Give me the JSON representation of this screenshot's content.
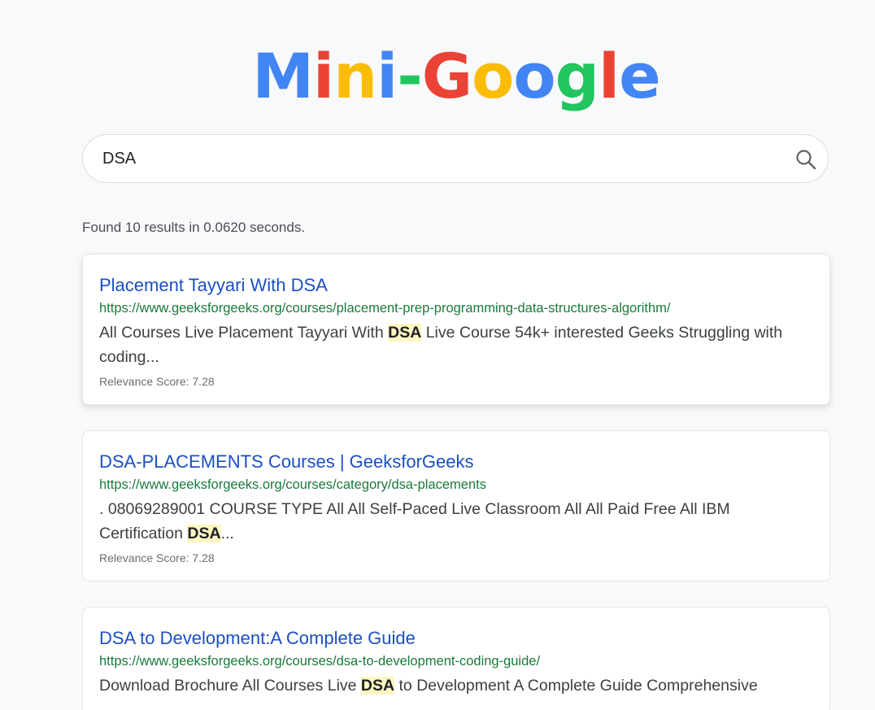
{
  "logo": {
    "letters": [
      {
        "char": "M",
        "color": "#4285f4"
      },
      {
        "char": "i",
        "color": "#ea4335"
      },
      {
        "char": "n",
        "color": "#fbbc05"
      },
      {
        "char": "i",
        "color": "#4285f4"
      },
      {
        "char": "-",
        "color": "#22c55e"
      },
      {
        "char": "G",
        "color": "#ea4335"
      },
      {
        "char": "o",
        "color": "#fbbc05"
      },
      {
        "char": "o",
        "color": "#4285f4"
      },
      {
        "char": "g",
        "color": "#22c55e"
      },
      {
        "char": "l",
        "color": "#ea4335"
      },
      {
        "char": "e",
        "color": "#4285f4"
      }
    ]
  },
  "search": {
    "value": "DSA",
    "icon": "search-icon"
  },
  "stats": {
    "text": "Found 10 results in 0.0620 seconds."
  },
  "colors": {
    "title_link": "#1a4fc4",
    "url": "#1a7a3a",
    "highlight_bg": "#fff6c2"
  },
  "results": [
    {
      "title": "Placement Tayyari With DSA",
      "url": "https://www.geeksforgeeks.org/courses/placement-prep-programming-data-structures-algorithm/",
      "snippet_before": "All Courses Live Placement Tayyari With ",
      "snippet_highlight": "DSA",
      "snippet_after": " Live Course 54k+ interested Geeks Struggling with coding...",
      "score": "Relevance Score: 7.28"
    },
    {
      "title": "DSA-PLACEMENTS Courses | GeeksforGeeks",
      "url": "https://www.geeksforgeeks.org/courses/category/dsa-placements",
      "snippet_before": ". 08069289001 COURSE TYPE All All Self-Paced Live Classroom All All Paid Free All IBM Certification ",
      "snippet_highlight": "DSA",
      "snippet_after": "...",
      "score": "Relevance Score: 7.28"
    },
    {
      "title": "DSA to Development:A Complete Guide",
      "url": "https://www.geeksforgeeks.org/courses/dsa-to-development-coding-guide/",
      "snippet_before": "Download Brochure All Courses Live ",
      "snippet_highlight": "DSA",
      "snippet_after": " to Development A Complete Guide Comprehensive",
      "score": ""
    }
  ]
}
